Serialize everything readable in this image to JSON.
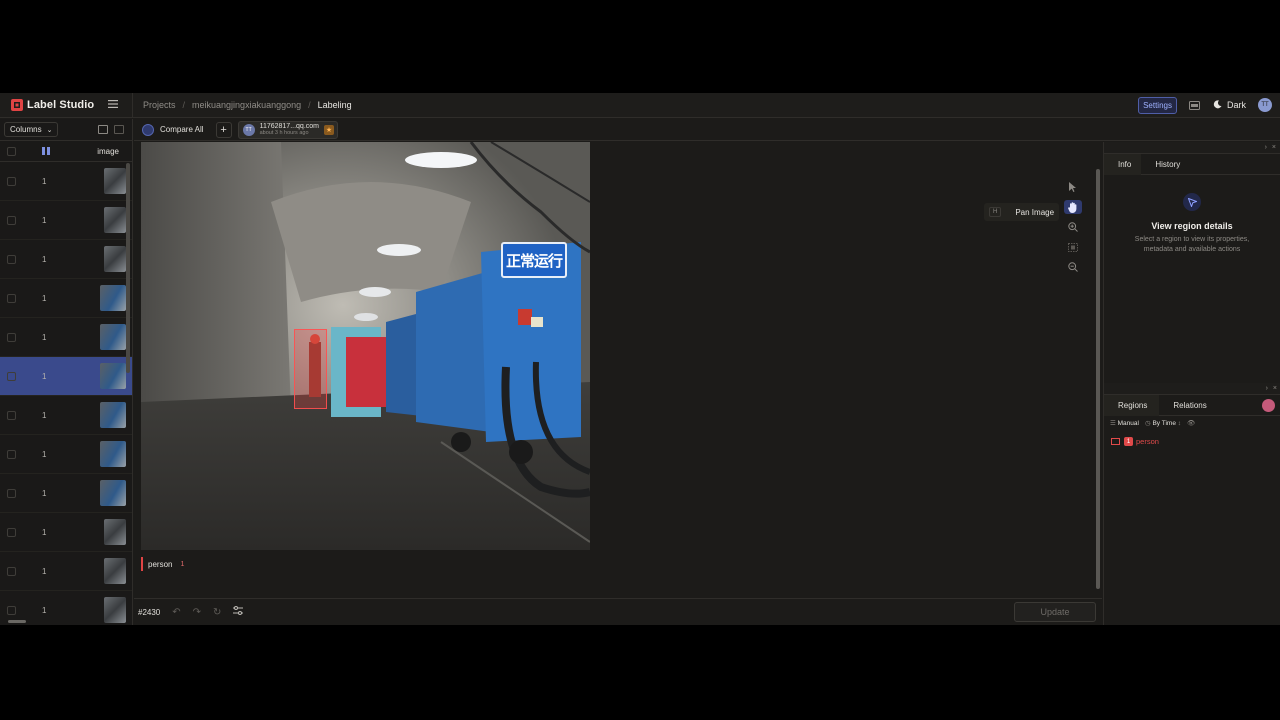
{
  "app": {
    "name": "Label Studio",
    "accent": "#e04444"
  },
  "breadcrumb": {
    "projects": "Projects",
    "project": "meikuangjingxiakuanggong",
    "current": "Labeling"
  },
  "topbar": {
    "settings_label": "Settings",
    "theme_label": "Dark",
    "avatar_initials": "TT"
  },
  "table": {
    "columns_label": "Columns",
    "image_header": "image",
    "rows": [
      {
        "value": "1",
        "thumb": "tall"
      },
      {
        "value": "1",
        "thumb": "tall"
      },
      {
        "value": "1",
        "thumb": "tall"
      },
      {
        "value": "1",
        "thumb": "wide"
      },
      {
        "value": "1",
        "thumb": "wide"
      },
      {
        "value": "1",
        "thumb": "wide"
      },
      {
        "value": "1",
        "thumb": "wide"
      },
      {
        "value": "1",
        "thumb": "wide"
      },
      {
        "value": "1",
        "thumb": "wide"
      },
      {
        "value": "1",
        "thumb": "tall"
      },
      {
        "value": "1",
        "thumb": "tall"
      },
      {
        "value": "1",
        "thumb": "tall"
      }
    ],
    "active_row": 5
  },
  "tabs": {
    "compare_all": "Compare All",
    "annotation_email": "11762817...qq.com",
    "annotation_time": "about 3 h hours ago",
    "annotation_avatar": "TT"
  },
  "canvas": {
    "sign_text": "正常运行",
    "tool_tooltip_key": "H",
    "tool_tooltip_text": "Pan Image"
  },
  "labels": {
    "person_label": "person",
    "person_hotkey": "1"
  },
  "bottombar": {
    "task_id": "#2430",
    "update_label": "Update"
  },
  "info_panel": {
    "tab_info": "Info",
    "tab_history": "History",
    "title": "View region details",
    "desc": "Select a region to view its properties, metadata and available actions"
  },
  "regions_panel": {
    "tab_regions": "Regions",
    "tab_relations": "Relations",
    "manual_label": "Manual",
    "by_time_label": "By Time",
    "region_label": "person",
    "region_num": "1"
  }
}
